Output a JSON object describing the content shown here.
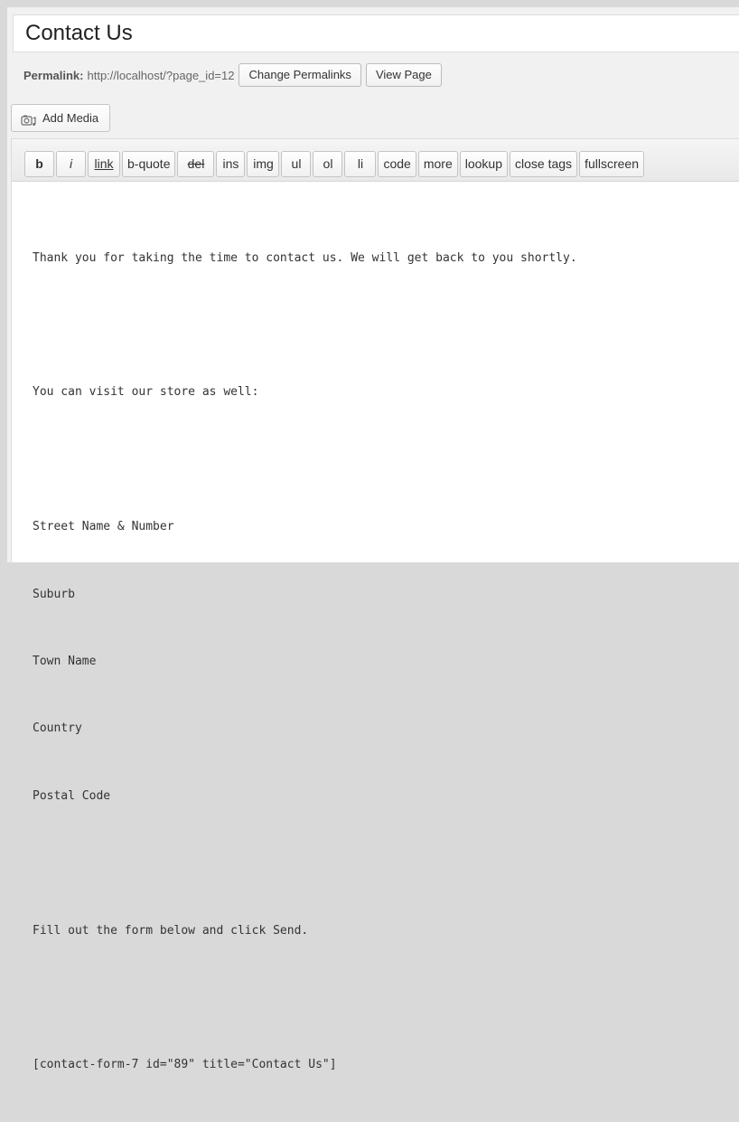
{
  "title": "Contact Us",
  "permalink": {
    "label": "Permalink:",
    "url": "http://localhost/?page_id=12",
    "change_button": "Change Permalinks",
    "view_button": "View Page"
  },
  "media": {
    "add_media_label": "Add Media",
    "icon": "add-media-icon"
  },
  "toolbar": {
    "buttons": [
      "b",
      "i",
      "link",
      "b-quote",
      "del",
      "ins",
      "img",
      "ul",
      "ol",
      "li",
      "code",
      "more",
      "lookup",
      "close tags",
      "fullscreen"
    ]
  },
  "editor": {
    "lines": [
      "Thank you for taking the time to contact us. We will get back to you shortly.",
      "",
      "You can visit our store as well:",
      "",
      "Street Name & Number",
      "Suburb",
      "Town Name",
      "Country",
      "Postal Code",
      "",
      "Fill out the form below and click Send.",
      "",
      "[contact-form-7 id=\"89\" title=\"Contact Us\"]"
    ]
  },
  "colors": {
    "background": "#d9d9d9",
    "panel": "#f1f1f1",
    "editor_background": "#ffffff",
    "toolbar_background": "#eeeeee",
    "text": "#333333"
  }
}
